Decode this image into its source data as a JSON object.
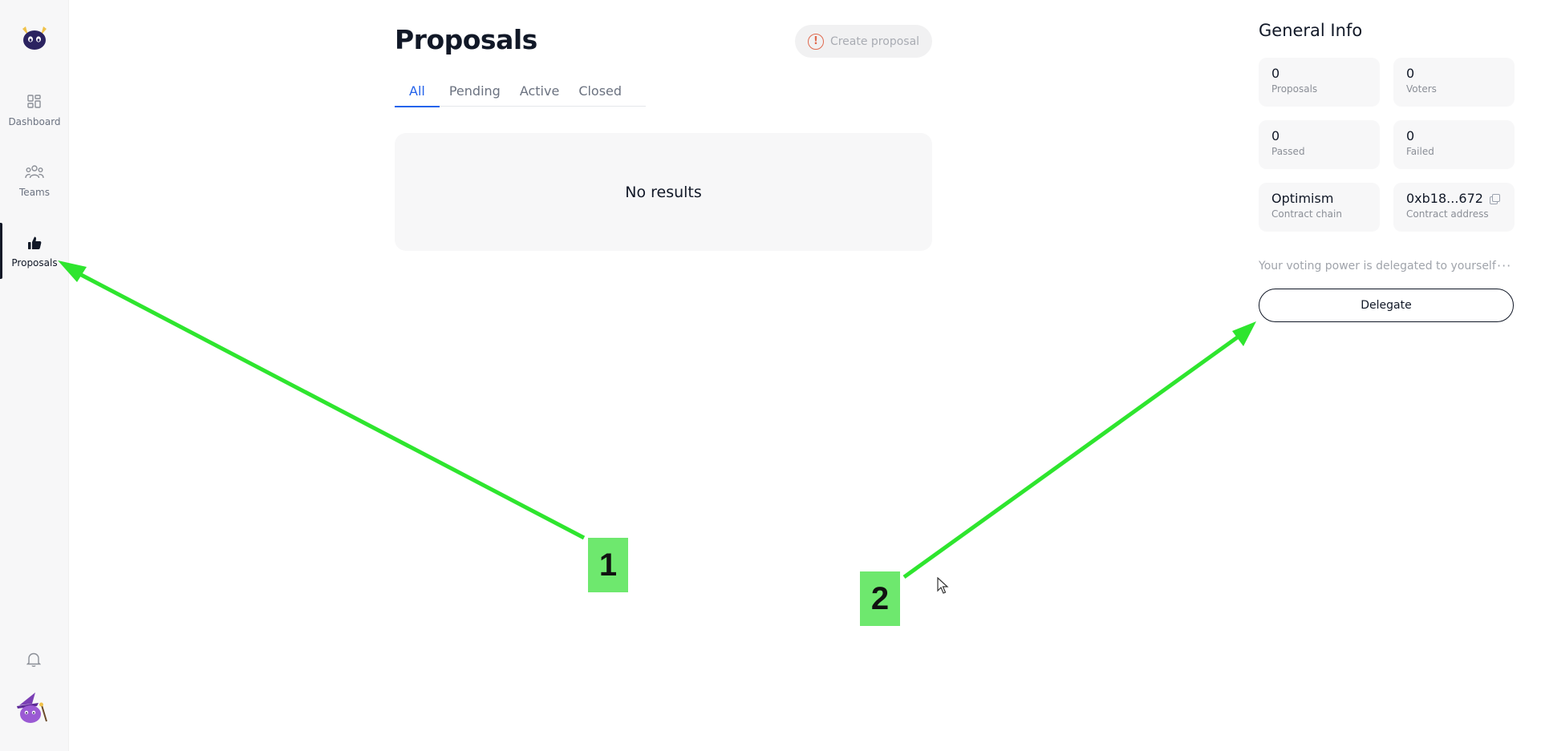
{
  "sidebar": {
    "items": [
      {
        "label": "Dashboard",
        "icon": "grid-icon"
      },
      {
        "label": "Teams",
        "icon": "people-icon"
      },
      {
        "label": "Proposals",
        "icon": "thumbs-up-icon"
      }
    ],
    "active": "Proposals"
  },
  "main": {
    "title": "Proposals",
    "create_button": "Create proposal",
    "tabs": [
      "All",
      "Pending",
      "Active",
      "Closed"
    ],
    "active_tab": "All",
    "empty_text": "No results"
  },
  "general_info": {
    "title": "General Info",
    "cards": [
      {
        "value": "0",
        "label": "Proposals"
      },
      {
        "value": "0",
        "label": "Voters"
      },
      {
        "value": "0",
        "label": "Passed"
      },
      {
        "value": "0",
        "label": "Failed"
      },
      {
        "value": "Optimism",
        "label": "Contract chain"
      },
      {
        "value": "0xb18...672",
        "label": "Contract address"
      }
    ],
    "voting_text": "Your voting power is delegated to yourself",
    "delegate_button": "Delegate"
  },
  "annotations": {
    "marker_1": "1",
    "marker_2": "2",
    "arrow_color": "#2ee52e",
    "marker_color": "#6ee86e"
  },
  "colors": {
    "accent": "#2563eb",
    "warning": "#e06a4f",
    "sidebar_bg": "#f7f7f8"
  }
}
